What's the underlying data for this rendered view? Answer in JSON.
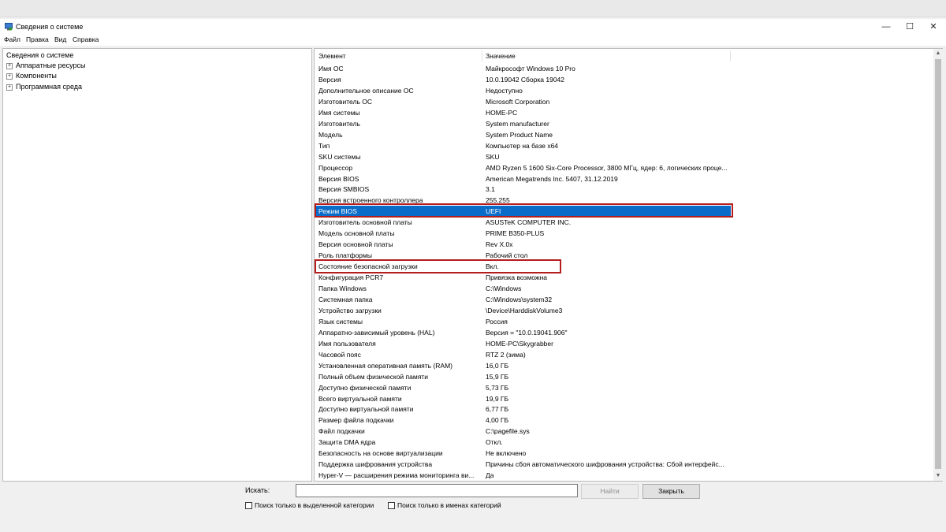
{
  "window": {
    "title": "Сведения о системе",
    "controls": {
      "minimize": "—",
      "maximize": "☐",
      "close": "✕"
    }
  },
  "menu": [
    "Файл",
    "Правка",
    "Вид",
    "Справка"
  ],
  "tree": {
    "root": "Сведения о системе",
    "nodes": [
      "Аппаратные ресурсы",
      "Компоненты",
      "Программная среда"
    ],
    "expander": "+"
  },
  "list": {
    "headers": {
      "element": "Элемент",
      "value": "Значение"
    },
    "rows": [
      [
        "Имя ОС",
        "Майкрософт Windows 10 Pro"
      ],
      [
        "Версия",
        "10.0.19042 Сборка 19042"
      ],
      [
        "Дополнительное описание ОС",
        "Недоступно"
      ],
      [
        "Изготовитель ОС",
        "Microsoft Corporation"
      ],
      [
        "Имя системы",
        "HOME-PC"
      ],
      [
        "Изготовитель",
        "System manufacturer"
      ],
      [
        "Модель",
        "System Product Name"
      ],
      [
        "Тип",
        "Компьютер на базе x64"
      ],
      [
        "SKU системы",
        "SKU"
      ],
      [
        "Процессор",
        "AMD Ryzen 5 1600 Six-Core Processor, 3800 МГц, ядер: 6, логических проце..."
      ],
      [
        "Версия BIOS",
        "American Megatrends Inc. 5407, 31.12.2019"
      ],
      [
        "Версия SMBIOS",
        "3.1"
      ],
      [
        "Версия встроенного контроллера",
        "255.255"
      ],
      [
        "Режим BIOS",
        "UEFI"
      ],
      [
        "Изготовитель основной платы",
        "ASUSTeK COMPUTER INC."
      ],
      [
        "Модель основной платы",
        "PRIME B350-PLUS"
      ],
      [
        "Версия основной платы",
        "Rev X.0x"
      ],
      [
        "Роль платформы",
        "Рабочий стол"
      ],
      [
        "Состояние безопасной загрузки",
        "Вкл."
      ],
      [
        "Конфигурация PCR7",
        "Привязка возможна"
      ],
      [
        "Папка Windows",
        "C:\\Windows"
      ],
      [
        "Системная папка",
        "C:\\Windows\\system32"
      ],
      [
        "Устройство загрузки",
        "\\Device\\HarddiskVolume3"
      ],
      [
        "Язык системы",
        "Россия"
      ],
      [
        "Аппаратно-зависимый уровень (HAL)",
        "Версия = \"10.0.19041.906\""
      ],
      [
        "Имя пользователя",
        "HOME-PC\\Skygrabber"
      ],
      [
        "Часовой пояс",
        "RTZ 2 (зима)"
      ],
      [
        "Установленная оперативная память (RAM)",
        "16,0 ГБ"
      ],
      [
        "Полный объем физической памяти",
        "15,9 ГБ"
      ],
      [
        "Доступно физической памяти",
        "5,73 ГБ"
      ],
      [
        "Всего виртуальной памяти",
        "19,9 ГБ"
      ],
      [
        "Доступно виртуальной памяти",
        "6,77 ГБ"
      ],
      [
        "Размер файла подкачки",
        "4,00 ГБ"
      ],
      [
        "Файл подкачки",
        "C:\\pagefile.sys"
      ],
      [
        "Защита DMA ядра",
        "Откл."
      ],
      [
        "Безопасность на основе виртуализации",
        "Не включено"
      ],
      [
        "Поддержка шифрования устройства",
        "Причины сбоя автоматического шифрования устройства: Сбой интерфейс..."
      ],
      [
        "Hyper-V — расширения режима мониторинга ви...",
        "Да"
      ]
    ],
    "selected_row": 13,
    "highlighted_rows": [
      13,
      18
    ]
  },
  "search": {
    "label": "Искать:",
    "value": "",
    "find_button": "Найти",
    "close_button": "Закрыть",
    "option_selected_category": "Поиск только в выделенной категории",
    "option_category_names": "Поиск только в именах категорий"
  },
  "scrollbar": {
    "up": "▲",
    "down": "▼"
  },
  "colors": {
    "selection": "#0a6cc9",
    "highlight_box": "#b51d1d"
  }
}
